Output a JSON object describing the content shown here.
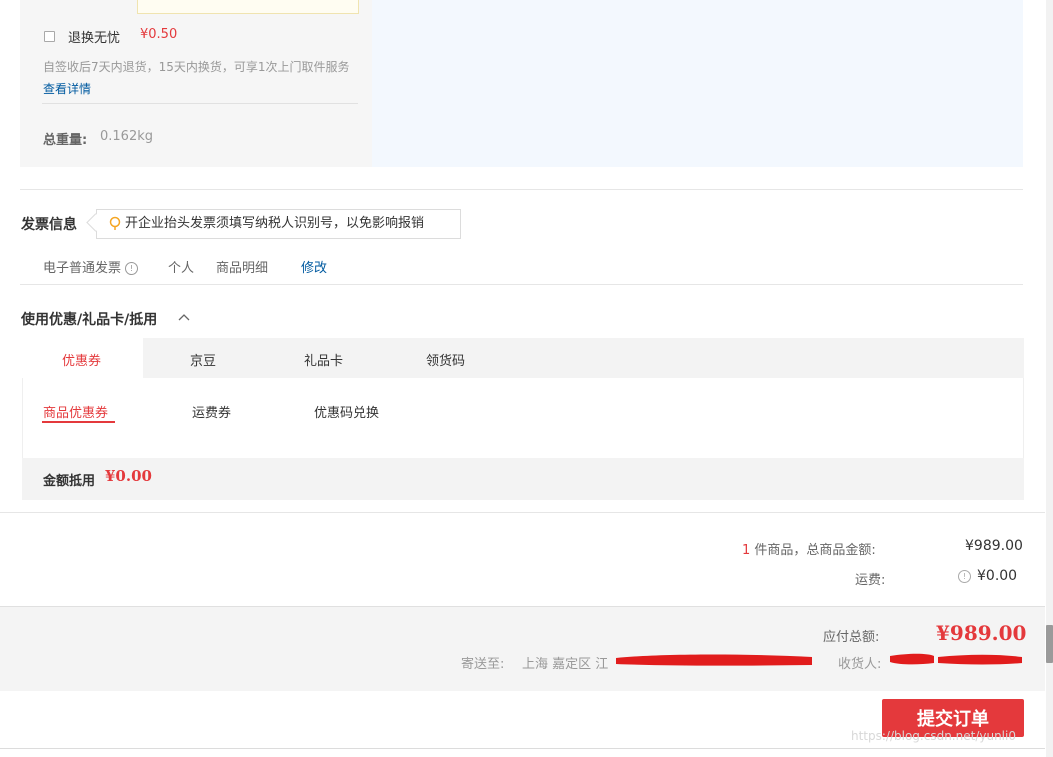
{
  "shipping": {
    "service_name": "退换无忧",
    "service_price": "¥0.50",
    "service_desc": "自签收后7天内退货，15天内换货，可享1次上门取件服务",
    "service_link": "查看详情",
    "weight_label": "总重量:",
    "weight_value": "0.162kg"
  },
  "invoice": {
    "title": "发票信息",
    "tip": "开企业抬头发票须填写纳税人识别号，以免影响报销",
    "type": "电子普通发票",
    "person": "个人",
    "detail": "商品明细",
    "edit": "修改"
  },
  "coupon": {
    "title": "使用优惠/礼品卡/抵用",
    "tabs": [
      "优惠券",
      "京豆",
      "礼品卡",
      "领货码"
    ],
    "subtabs": [
      "商品优惠券",
      "运费券",
      "优惠码兑换"
    ],
    "deduct_label": "金额抵用",
    "deduct_value": "¥0.00"
  },
  "summary": {
    "item_count": "1",
    "item_label": "件商品，总商品金额:",
    "item_total": "¥989.00",
    "freight_label": "运费:",
    "freight_value": "¥0.00",
    "payable_label": "应付总额:",
    "payable_value": "¥989.00",
    "ship_to_label": "寄送至:",
    "ship_to_addr": "上海 嘉定区 江",
    "receiver_label": "收货人:"
  },
  "actions": {
    "submit": "提交订单"
  },
  "watermark": "https://blog.csdn.net/yunli0",
  "colors": {
    "accent": "#e4393c",
    "link": "#005aa0"
  }
}
